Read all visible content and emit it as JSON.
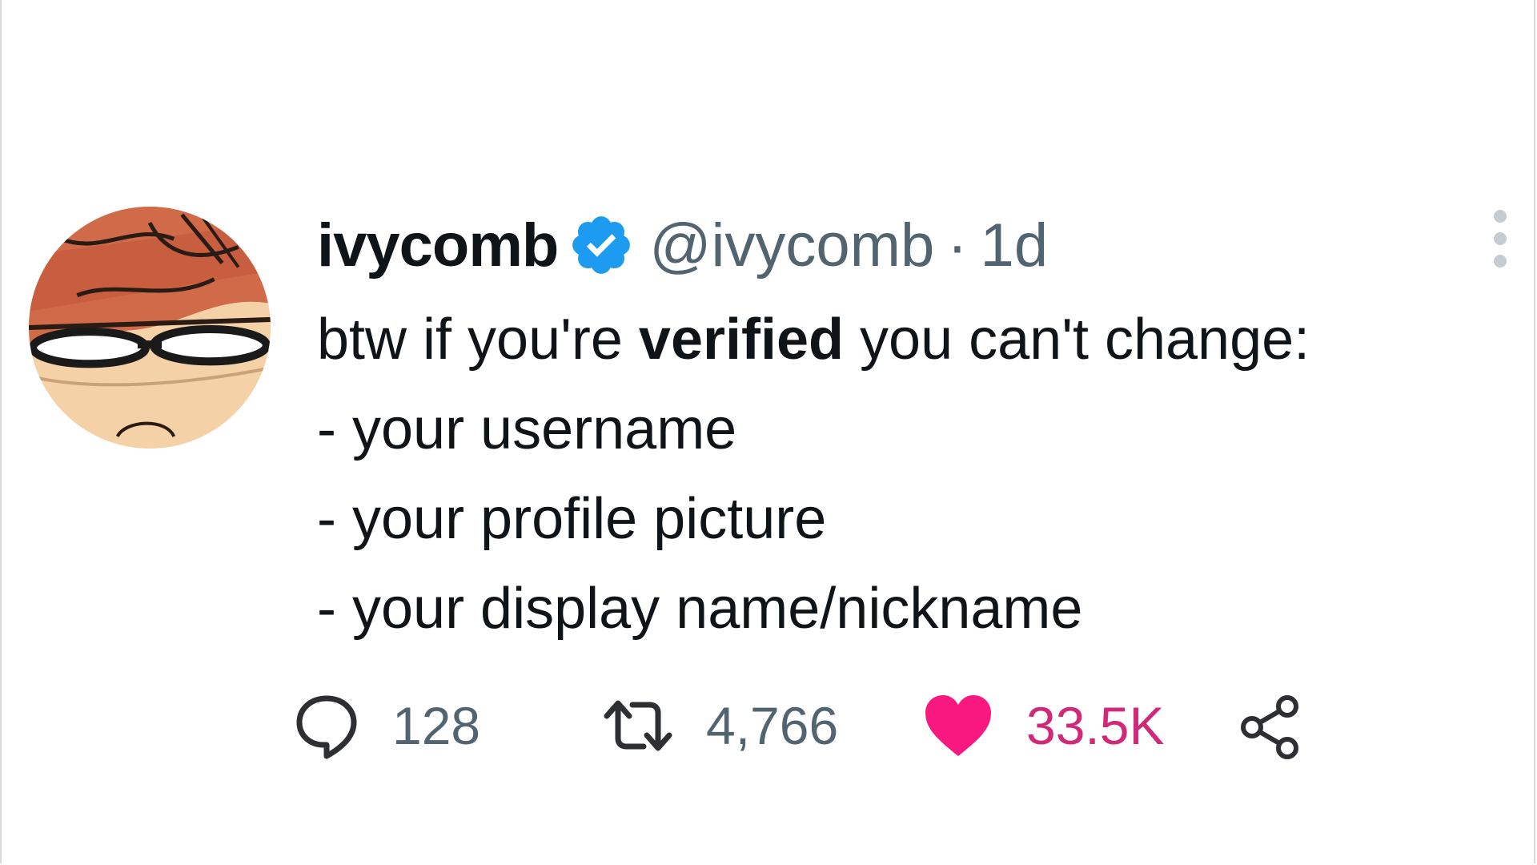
{
  "tweet": {
    "display_name": "ivycomb",
    "handle": "@ivycomb",
    "separator": "·",
    "time": "1d",
    "text": {
      "line1_pre": "btw if you're ",
      "line1_bold": "verified",
      "line1_post": " you can't change:",
      "line2": "- your username",
      "line3": "- your profile picture",
      "line4": "- your display name/nickname"
    }
  },
  "actions": {
    "reply_count": "128",
    "retweet_count": "4,766",
    "like_count": "33.5K",
    "liked": true
  },
  "icons": {
    "avatar": "cartoon-face-avatar",
    "verified": "verified-badge-icon",
    "more": "more-vertical-icon",
    "reply": "reply-bubble-icon",
    "retweet": "retweet-icon",
    "like": "heart-icon",
    "share": "share-icon"
  },
  "colors": {
    "verified_blue": "#1d9bf0",
    "muted_text": "#536471",
    "like_pink": "#f91880",
    "like_count_pink": "#d0297a"
  }
}
